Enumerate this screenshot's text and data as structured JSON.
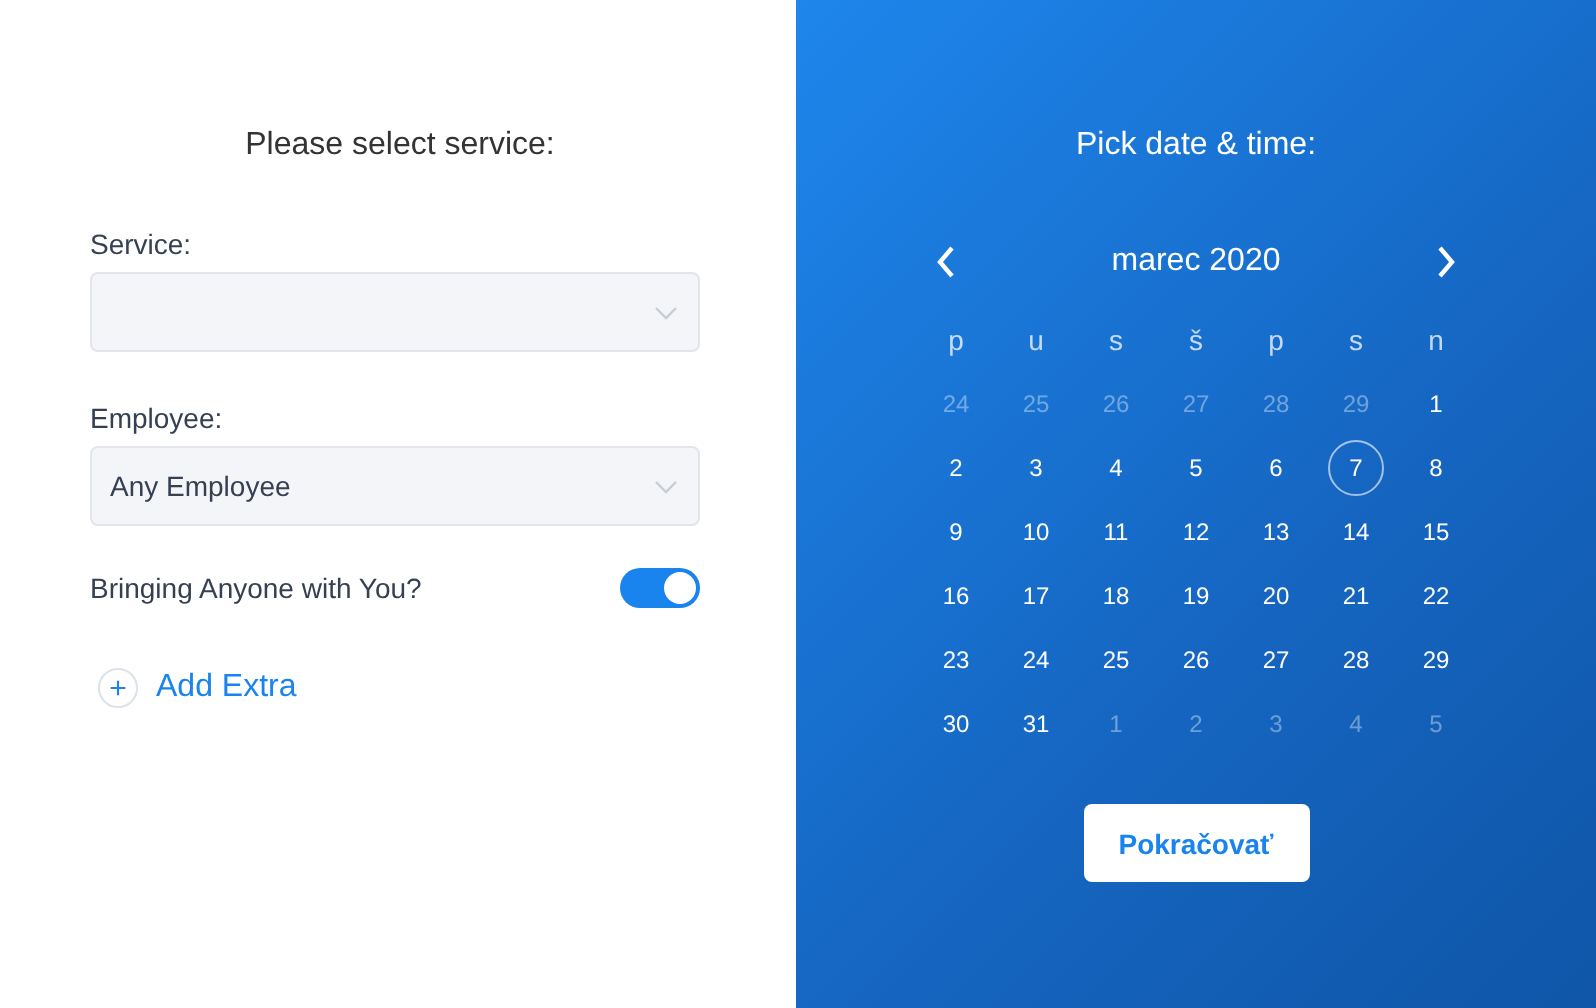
{
  "left": {
    "title": "Please select service:",
    "fields": [
      {
        "label": "Service:"
      },
      {
        "label": "Employee:",
        "value": "Any Employee"
      }
    ],
    "toggle": {
      "label": "Bringing Anyone with You?",
      "on": true
    },
    "add_extra": {
      "icon": "+",
      "label": "Add Extra"
    }
  },
  "right": {
    "title": "Pick date & time:",
    "month": "marec 2020",
    "weekdays": [
      "p",
      "u",
      "s",
      "š",
      "p",
      "s",
      "n"
    ],
    "days": [
      {
        "label": "24",
        "muted": true,
        "selected": false
      },
      {
        "label": "25",
        "muted": true,
        "selected": false
      },
      {
        "label": "26",
        "muted": true,
        "selected": false
      },
      {
        "label": "27",
        "muted": true,
        "selected": false
      },
      {
        "label": "28",
        "muted": true,
        "selected": false
      },
      {
        "label": "29",
        "muted": true,
        "selected": false
      },
      {
        "label": "1",
        "muted": false,
        "selected": false
      },
      {
        "label": "2",
        "muted": false,
        "selected": false
      },
      {
        "label": "3",
        "muted": false,
        "selected": false
      },
      {
        "label": "4",
        "muted": false,
        "selected": false
      },
      {
        "label": "5",
        "muted": false,
        "selected": false
      },
      {
        "label": "6",
        "muted": false,
        "selected": false
      },
      {
        "label": "7",
        "muted": false,
        "selected": true
      },
      {
        "label": "8",
        "muted": false,
        "selected": false
      },
      {
        "label": "9",
        "muted": false,
        "selected": false
      },
      {
        "label": "10",
        "muted": false,
        "selected": false
      },
      {
        "label": "11",
        "muted": false,
        "selected": false
      },
      {
        "label": "12",
        "muted": false,
        "selected": false
      },
      {
        "label": "13",
        "muted": false,
        "selected": false
      },
      {
        "label": "14",
        "muted": false,
        "selected": false
      },
      {
        "label": "15",
        "muted": false,
        "selected": false
      },
      {
        "label": "16",
        "muted": false,
        "selected": false
      },
      {
        "label": "17",
        "muted": false,
        "selected": false
      },
      {
        "label": "18",
        "muted": false,
        "selected": false
      },
      {
        "label": "19",
        "muted": false,
        "selected": false
      },
      {
        "label": "20",
        "muted": false,
        "selected": false
      },
      {
        "label": "21",
        "muted": false,
        "selected": false
      },
      {
        "label": "22",
        "muted": false,
        "selected": false
      },
      {
        "label": "23",
        "muted": false,
        "selected": false
      },
      {
        "label": "24",
        "muted": false,
        "selected": false
      },
      {
        "label": "25",
        "muted": false,
        "selected": false
      },
      {
        "label": "26",
        "muted": false,
        "selected": false
      },
      {
        "label": "27",
        "muted": false,
        "selected": false
      },
      {
        "label": "28",
        "muted": false,
        "selected": false
      },
      {
        "label": "29",
        "muted": false,
        "selected": false
      },
      {
        "label": "30",
        "muted": false,
        "selected": false
      },
      {
        "label": "31",
        "muted": false,
        "selected": false
      },
      {
        "label": "1",
        "muted": true,
        "selected": false
      },
      {
        "label": "2",
        "muted": true,
        "selected": false
      },
      {
        "label": "3",
        "muted": true,
        "selected": false
      },
      {
        "label": "4",
        "muted": true,
        "selected": false
      },
      {
        "label": "5",
        "muted": true,
        "selected": false
      }
    ],
    "button": "Pokračovať"
  }
}
